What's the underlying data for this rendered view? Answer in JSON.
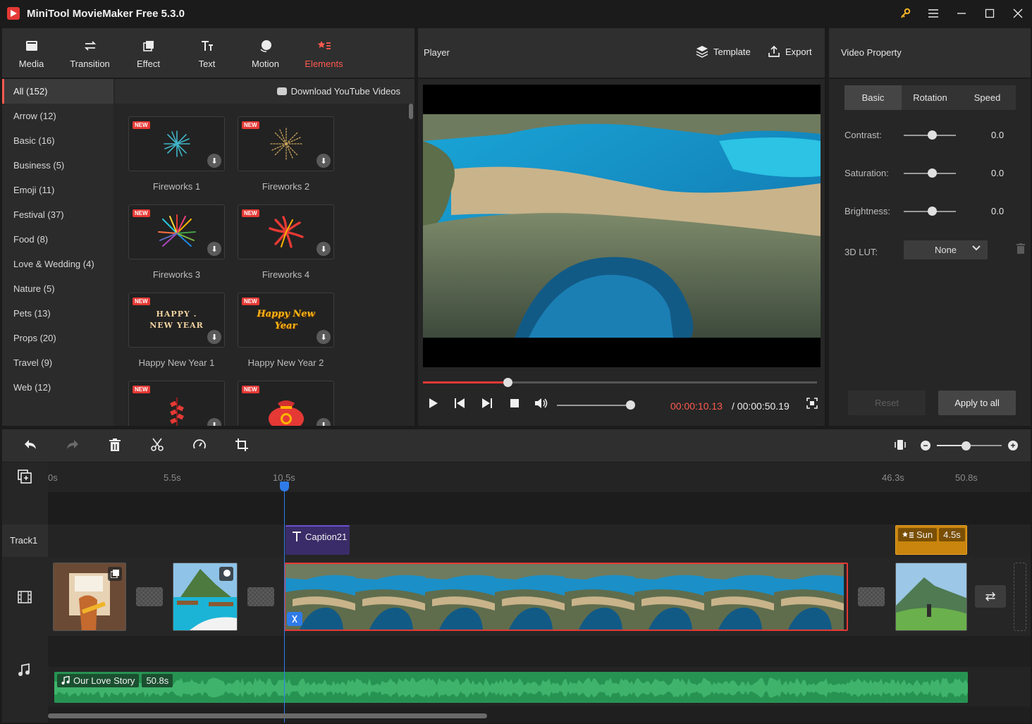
{
  "window": {
    "title": "MiniTool MovieMaker Free 5.3.0"
  },
  "toolbar": {
    "tabs": [
      {
        "label": "Media",
        "icon": "media-icon"
      },
      {
        "label": "Transition",
        "icon": "transition-icon"
      },
      {
        "label": "Effect",
        "icon": "effect-icon"
      },
      {
        "label": "Text",
        "icon": "text-icon"
      },
      {
        "label": "Motion",
        "icon": "motion-icon"
      },
      {
        "label": "Elements",
        "icon": "elements-icon",
        "active": true
      }
    ],
    "accent": "#ff5a4f"
  },
  "library": {
    "categories": [
      {
        "label": "All (152)",
        "active": true
      },
      {
        "label": "Arrow (12)"
      },
      {
        "label": "Basic (16)"
      },
      {
        "label": "Business (5)"
      },
      {
        "label": "Emoji (11)"
      },
      {
        "label": "Festival (37)"
      },
      {
        "label": "Food (8)"
      },
      {
        "label": "Love & Wedding (4)"
      },
      {
        "label": "Nature (5)"
      },
      {
        "label": "Pets (13)"
      },
      {
        "label": "Props (20)"
      },
      {
        "label": "Travel (9)"
      },
      {
        "label": "Web (12)"
      }
    ],
    "download_link": "Download YouTube Videos",
    "new_badge": "NEW",
    "items": [
      {
        "label": "Fireworks 1"
      },
      {
        "label": "Fireworks 2"
      },
      {
        "label": "Fireworks 3"
      },
      {
        "label": "Fireworks 4"
      },
      {
        "label": "Happy New Year 1",
        "art": "HAPPY . NEW YEAR"
      },
      {
        "label": "Happy New Year 2",
        "art": "Happy New Year"
      },
      {
        "label": ""
      },
      {
        "label": ""
      }
    ]
  },
  "player": {
    "title": "Player",
    "template_label": "Template",
    "export_label": "Export",
    "current_time": "00:00:10.13",
    "total_time": "/ 00:00:50.19",
    "progress": 0.215,
    "volume": 0.95
  },
  "property": {
    "title": "Video Property",
    "tabs": [
      {
        "label": "Basic",
        "active": true
      },
      {
        "label": "Rotation"
      },
      {
        "label": "Speed"
      }
    ],
    "rows": [
      {
        "label": "Contrast:",
        "value": "0.0",
        "level": 0.5
      },
      {
        "label": "Saturation:",
        "value": "0.0",
        "level": 0.5
      },
      {
        "label": "Brightness:",
        "value": "0.0",
        "level": 0.5
      }
    ],
    "lut_label": "3D LUT:",
    "lut_value": "None",
    "reset_label": "Reset",
    "apply_label": "Apply to all"
  },
  "timeline": {
    "ruler": [
      "0s",
      "5.5s",
      "10.5s",
      "46.3s",
      "50.8s"
    ],
    "track1_label": "Track1",
    "caption_clip": "Caption21",
    "element_clip": {
      "name": "Sun",
      "duration": "4.5s"
    },
    "audio_clip": {
      "name": "Our Love Story",
      "duration": "50.8s"
    },
    "zoom_level": 0.45
  }
}
